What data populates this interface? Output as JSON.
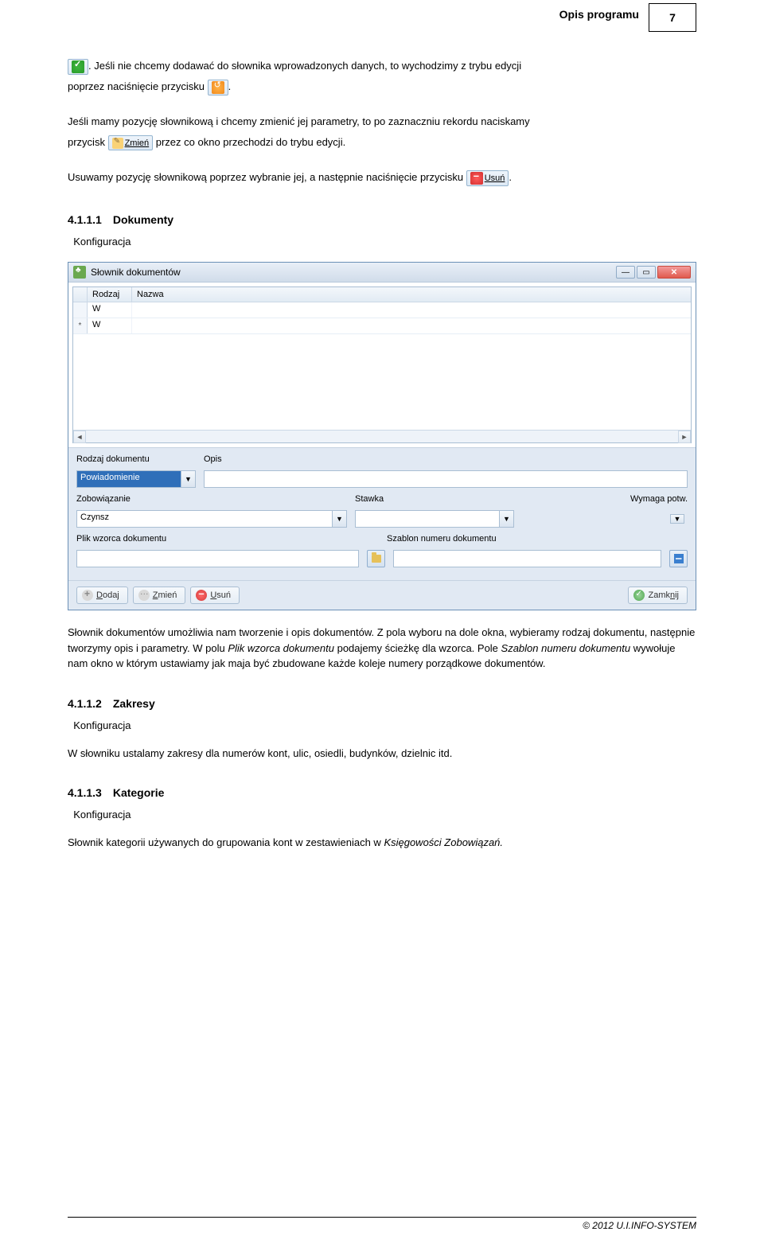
{
  "header": {
    "title": "Opis programu",
    "page": "7"
  },
  "p1a": ". Jeśli nie chcemy dodawać do słownika wprowadzonych danych, to wychodzimy z trybu edycji",
  "p1b": "poprzez naciśnięcie przycisku ",
  "p2a": "Jeśli mamy pozycję słownikową i chcemy zmienić jej parametry, to po zaznaczniu rekordu naciskamy",
  "p2b": "przycisk ",
  "p2c": " przez co okno przechodzi do trybu edycji.",
  "p3a": "Usuwamy pozycję słownikową poprzez wybranie jej, a następnie naciśnięcie przycisku ",
  "btn_zmien": "Zmień",
  "btn_usun": "Usuń",
  "s1": {
    "num": "4.1.1.1",
    "title": "Dokumenty",
    "bullet": "Konfiguracja"
  },
  "win": {
    "title": "Słownik dokumentów",
    "cols": {
      "rodzaj": "Rodzaj",
      "nazwa": "Nazwa"
    },
    "rows": [
      {
        "rodzaj": "W",
        "nazwa": ""
      },
      {
        "rodzaj": "W",
        "nazwa": ""
      }
    ],
    "form": {
      "lbl_rodzaj": "Rodzaj dokumentu",
      "lbl_opis": "Opis",
      "val_rodzaj": "Powiadomienie",
      "lbl_zobo": "Zobowiązanie",
      "val_zobo": "Czynsz",
      "lbl_stawka": "Stawka",
      "lbl_wymaga": "Wymaga potw.",
      "lbl_plik": "Plik wzorca dokumentu",
      "lbl_szablon": "Szablon numeru dokumentu"
    },
    "buttons": {
      "dodaj": "Dodaj",
      "zmien": "Zmień",
      "usun": "Usuń",
      "zamknij": "Zamknij"
    }
  },
  "desc1": "Słownik dokumentów umożliwia nam tworzenie i opis dokumentów. Z pola wyboru na dole okna, wybieramy rodzaj dokumentu, następnie tworzymy opis i parametry. W polu ",
  "desc1_i1": "Plik wzorca dokumentu",
  "desc1b": " podajemy ścieżkę dla wzorca. Pole ",
  "desc1_i2": "Szablon numeru dokumentu",
  "desc1c": " wywołuje nam okno w którym ustawiamy jak maja być zbudowane każde koleje numery porządkowe dokumentów.",
  "s2": {
    "num": "4.1.1.2",
    "title": "Zakresy",
    "bullet": "Konfiguracja",
    "text": "W słowniku ustalamy zakresy dla numerów kont, ulic, osiedli, budynków, dzielnic itd."
  },
  "s3": {
    "num": "4.1.1.3",
    "title": "Kategorie",
    "bullet": "Konfiguracja",
    "text": "Słownik kategorii używanych do grupowania kont w zestawieniach w ",
    "i": "Księgowości Zobowiązań."
  },
  "footer": "© 2012 U.I.INFO-SYSTEM"
}
